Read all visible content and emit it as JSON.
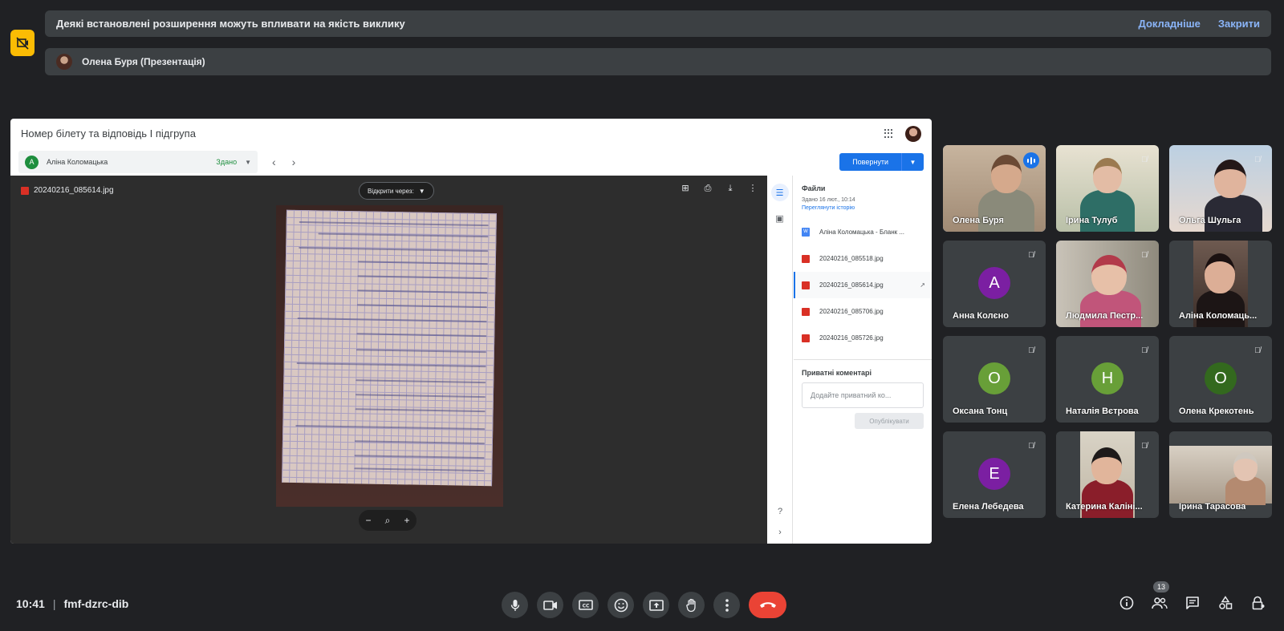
{
  "notice": {
    "message": "Деякі встановлені розширення можуть впливати на якість виклику",
    "learn_more": "Докладніше",
    "close": "Закрити"
  },
  "presenter_bar": {
    "label": "Олена Буря (Презентація)"
  },
  "presentation": {
    "title": "Номер білету та відповідь І підгрупа",
    "student": {
      "initial": "А",
      "name": "Аліна Коломацька",
      "status": "Здано"
    },
    "return_button": "Повернути",
    "file_name": "20240216_085614.jpg",
    "open_with": "Відкрити через:",
    "files_panel": {
      "heading": "Файли",
      "submitted": "Здано 16 лют., 10:14",
      "history": "Переглянути історію",
      "items": [
        {
          "name": "Аліна Коломацька - Бланк ...",
          "type": "doc",
          "icon_letter": "W"
        },
        {
          "name": "20240216_085518.jpg",
          "type": "image"
        },
        {
          "name": "20240216_085614.jpg",
          "type": "image",
          "selected": true
        },
        {
          "name": "20240216_085706.jpg",
          "type": "image"
        },
        {
          "name": "20240216_085726.jpg",
          "type": "image"
        }
      ],
      "private_comments": "Приватні коментарі",
      "comment_placeholder": "Додайте приватний ко...",
      "publish": "Опублікувати"
    }
  },
  "participants": [
    {
      "name": "Олена Буря",
      "speaking": true,
      "video": true
    },
    {
      "name": "Ірина Тулуб",
      "muted": true,
      "video": true
    },
    {
      "name": "Ольга Шульга",
      "muted": true,
      "video": true
    },
    {
      "name": "Анна Колєно",
      "muted": true,
      "initial": "А",
      "color": "#7b1fa2"
    },
    {
      "name": "Людмила Пестр...",
      "muted": true,
      "video": true
    },
    {
      "name": "Аліна Коломаць...",
      "video": true
    },
    {
      "name": "Оксана Тонц",
      "muted": true,
      "initial": "О",
      "color": "#689f38"
    },
    {
      "name": "Наталія Вєтрова",
      "muted": true,
      "initial": "Н",
      "color": "#689f38"
    },
    {
      "name": "Олена Крекотень",
      "muted": true,
      "initial": "О",
      "color": "#33691e"
    },
    {
      "name": "Елена Лебедева",
      "muted": true,
      "initial": "Е",
      "color": "#7b1fa2"
    },
    {
      "name": "Катерина Каліні...",
      "muted": true,
      "video": true
    },
    {
      "name": "Ірина Тарасова",
      "video": true
    }
  ],
  "meeting": {
    "time": "10:41",
    "separator": "|",
    "code": "fmf-dzrc-dib",
    "participant_count": "13"
  }
}
